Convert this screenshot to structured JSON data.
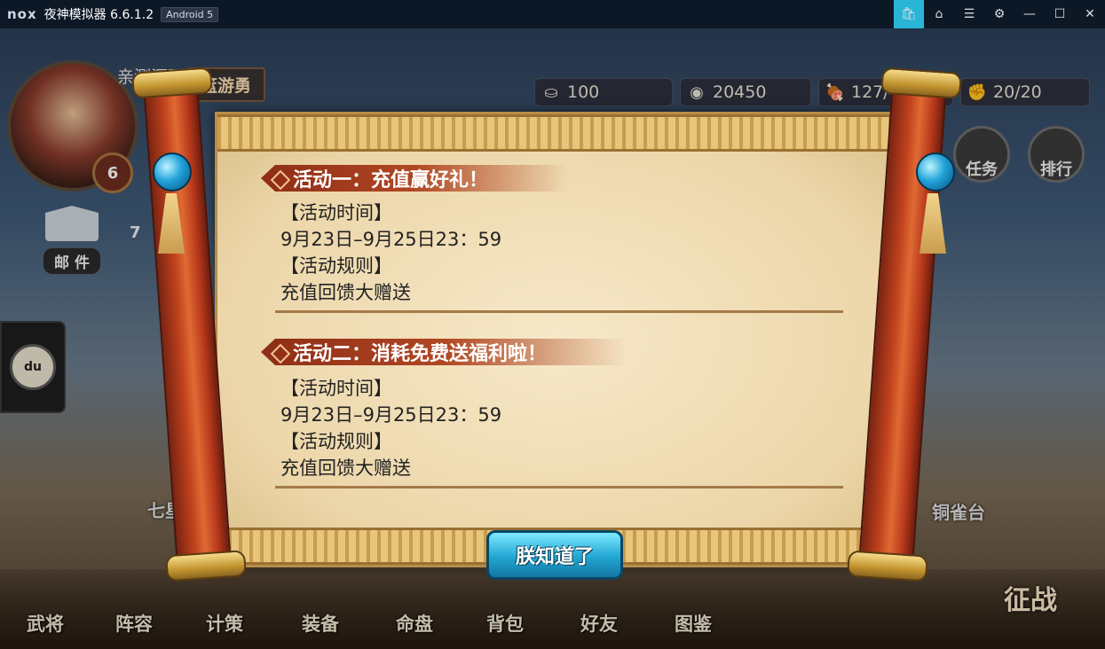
{
  "window": {
    "logo": "nox",
    "title": "夜神模拟器 6.6.1.2",
    "android_badge": "Android 5",
    "buttons": [
      "store-icon",
      "home-icon",
      "menu-icon",
      "settings-icon",
      "minimize-icon",
      "maximize-icon",
      "close-icon"
    ]
  },
  "player": {
    "name": "亲测源码网",
    "title": "篮游勇",
    "level": "6"
  },
  "resources": [
    {
      "icon": "ingot-icon",
      "value": "100"
    },
    {
      "icon": "coin-icon",
      "value": "20450"
    },
    {
      "icon": "meat-icon",
      "value": "127/150"
    },
    {
      "icon": "fist-icon",
      "value": "20/20"
    }
  ],
  "side": {
    "mail_label": "邮 件",
    "mail_count": "7",
    "baidu_label": "du"
  },
  "top_buttons": {
    "task": "任务",
    "rank": "排行"
  },
  "map_labels": {
    "left": "七星",
    "right": "铜雀台"
  },
  "nav": [
    "武将",
    "阵容",
    "计策",
    "装备",
    "命盘",
    "背包",
    "好友",
    "图鉴"
  ],
  "fight_label": "征战",
  "dialog": {
    "sections": [
      {
        "title": "活动一：充值赢好礼！",
        "time_header": "【活动时间】",
        "time": "9月23日–9月25日23：59",
        "rule_header": "【活动规则】",
        "rule": "充值回馈大赠送"
      },
      {
        "title": "活动二：消耗免费送福利啦！",
        "time_header": "【活动时间】",
        "time": "9月23日–9月25日23：59",
        "rule_header": "【活动规则】",
        "rule": "充值回馈大赠送"
      }
    ],
    "confirm_label": "朕知道了"
  }
}
